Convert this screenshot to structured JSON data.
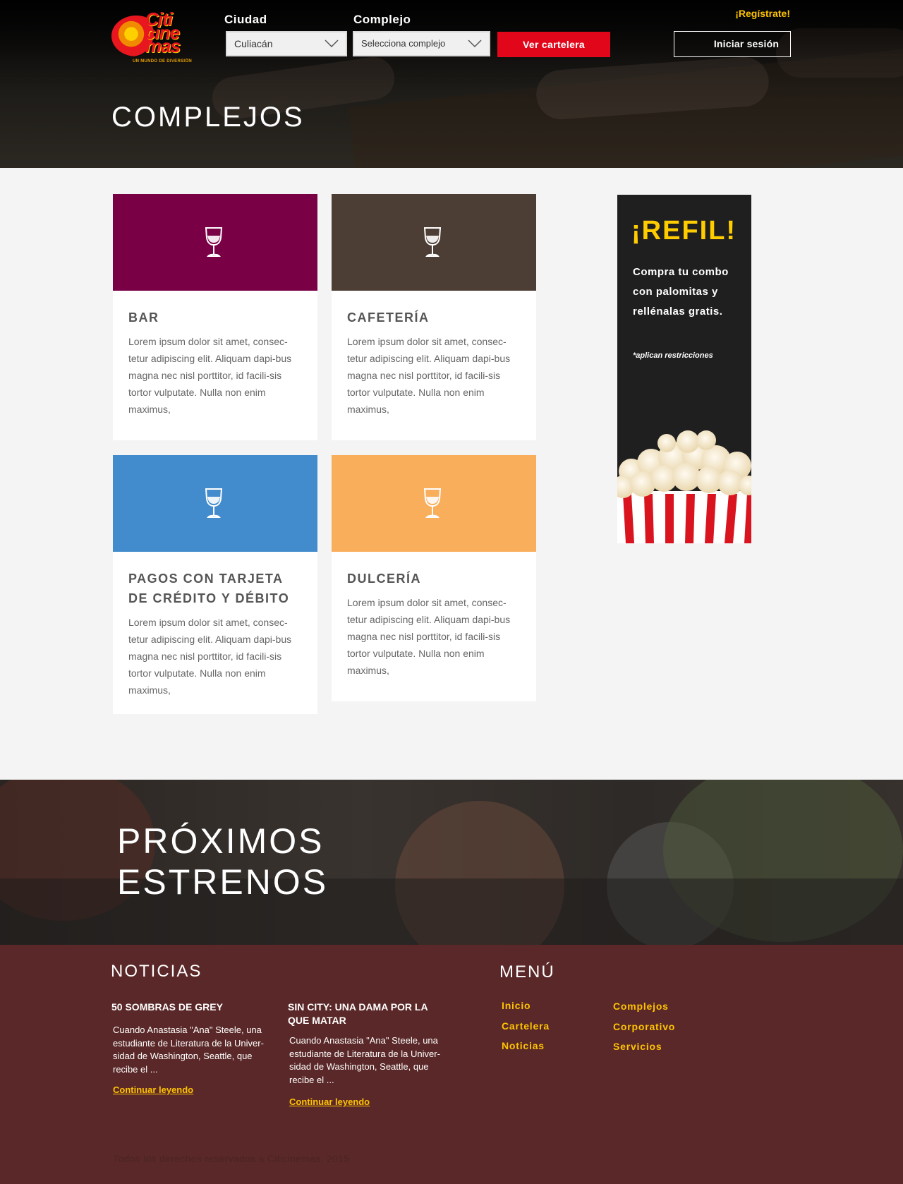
{
  "header": {
    "logo_text": "Citicinemas",
    "logo_tagline": "UN MUNDO DE DIVERSIÓN",
    "city_label": "Ciudad",
    "city_value": "Culiacán",
    "complex_label": "Complejo",
    "complex_placeholder": "Selecciona complejo",
    "showtimes_button": "Ver cartelera",
    "register_link": "¡Regístrate!",
    "login_button": "Iniciar sesión"
  },
  "page_title": "COMPLEJOS",
  "services": [
    {
      "title": "BAR",
      "color": "#7a0046",
      "icon": "wine-glass-icon",
      "text": "Lorem ipsum dolor sit amet, consec-tetur adipiscing elit. Aliquam dapi-bus magna nec nisl porttitor, id facili-sis tortor vulputate. Nulla non enim maximus,"
    },
    {
      "title": "CAFETERÍA",
      "color": "#4d3e35",
      "icon": "wine-glass-icon",
      "text": "Lorem ipsum dolor sit amet, consec-tetur adipiscing elit. Aliquam dapi-bus magna nec nisl porttitor, id facili-sis tortor vulputate. Nulla non enim maximus,"
    },
    {
      "title": "PAGOS CON TARJETA DE CRÉDITO Y DÉBITO",
      "color": "#428bcc",
      "icon": "wine-glass-icon",
      "text": "Lorem ipsum dolor sit amet, consec-tetur adipiscing elit. Aliquam dapi-bus magna nec nisl porttitor, id facili-sis tortor vulputate. Nulla non enim maximus,"
    },
    {
      "title": "DULCERÍA",
      "color": "#f9ae5b",
      "icon": "wine-glass-icon",
      "text": "Lorem ipsum dolor sit amet, consec-tetur adipiscing elit. Aliquam dapi-bus magna nec nisl porttitor, id facili-sis tortor vulputate. Nulla non enim maximus,"
    }
  ],
  "promo": {
    "title": "¡REFIL!",
    "text": "Compra tu combo con palomitas y rellénalas gratis.",
    "note": "*aplican restricciones"
  },
  "upcoming": {
    "title_line1": "PRÓXIMOS",
    "title_line2": "ESTRENOS"
  },
  "footer": {
    "news_heading": "NOTICIAS",
    "news": [
      {
        "title": "50 SOMBRAS DE GREY",
        "body": "Cuando Anastasia \"Ana\" Steele, una estudiante de Literatura de la Univer-sidad de Washington, Seattle, que recibe el ...",
        "link": "Continuar leyendo"
      },
      {
        "title": "SIN CITY: UNA DAMA POR LA QUE MATAR",
        "body": "Cuando Anastasia \"Ana\" Steele, una estudiante de Literatura de la Univer-sidad de Washington, Seattle, que recibe el ...",
        "link": "Continuar leyendo"
      }
    ],
    "menu_heading": "MENÚ",
    "menu_col1": [
      "Inicio",
      "Cartelera",
      "Noticias"
    ],
    "menu_col2": [
      "Complejos",
      "Corporativo",
      "Servicios"
    ],
    "copyright": "Todos los derechos reservados a Citicinemas, 2015"
  }
}
